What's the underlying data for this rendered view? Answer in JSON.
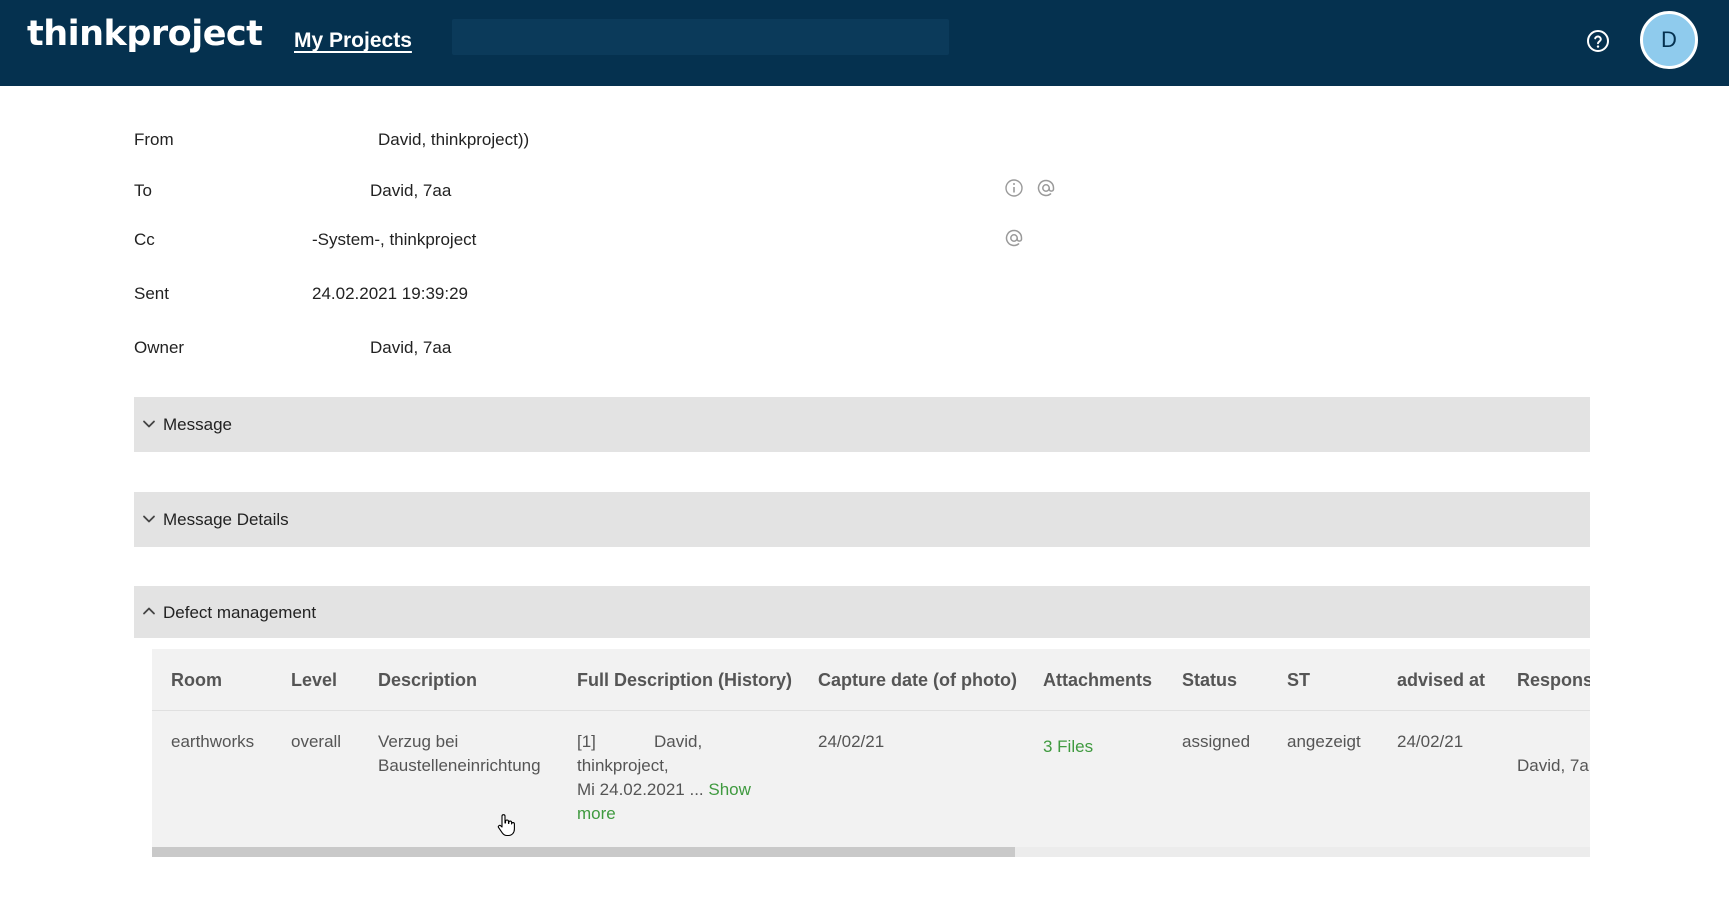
{
  "header": {
    "logo": "thinkproject",
    "nav_link": "My Projects",
    "avatar_initial": "D"
  },
  "fields": {
    "from": {
      "label": "From",
      "value": "David, thinkproject))"
    },
    "to": {
      "label": "To",
      "value": "David, 7aa"
    },
    "cc": {
      "label": "Cc",
      "value": "-System-, thinkproject"
    },
    "sent": {
      "label": "Sent",
      "value": "24.02.2021 19:39:29"
    },
    "owner": {
      "label": "Owner",
      "value": "David, 7aa"
    }
  },
  "sections": {
    "message": "Message",
    "message_details": "Message Details",
    "defect_management": "Defect management"
  },
  "table": {
    "columns": [
      "Room",
      "Level",
      "Description",
      "Full Description (History)",
      "Capture date (of photo)",
      "Attachments",
      "Status",
      "ST",
      "advised at",
      "Respons"
    ],
    "row": {
      "room": "earthworks",
      "level": "overall",
      "description_line1": "Verzug bei",
      "description_line2": "Baustelleneinrichtung",
      "history_line1_a": "[1]",
      "history_line1_b": "David,",
      "history_line2": "thinkproject,",
      "history_line3": "Mi 24.02.2021 ...",
      "show_label": "Show",
      "more_label": "more",
      "capture_date": "24/02/21",
      "attachments": "3 Files",
      "status": "assigned",
      "st": "angezeigt",
      "advised_at": "24/02/21",
      "responsible": "David, 7a"
    }
  },
  "colors": {
    "topbar": "#05314f",
    "avatar": "#8fcbed",
    "section_bg": "#e3e3e3",
    "link_green": "#3f9a3f"
  },
  "icons": {
    "help": "help-circle-icon",
    "info": "info-icon",
    "mention": "at-sign-icon",
    "collapse": "chevron-down-icon",
    "expand": "chevron-up-icon",
    "cursor": "hand-pointer-icon"
  }
}
